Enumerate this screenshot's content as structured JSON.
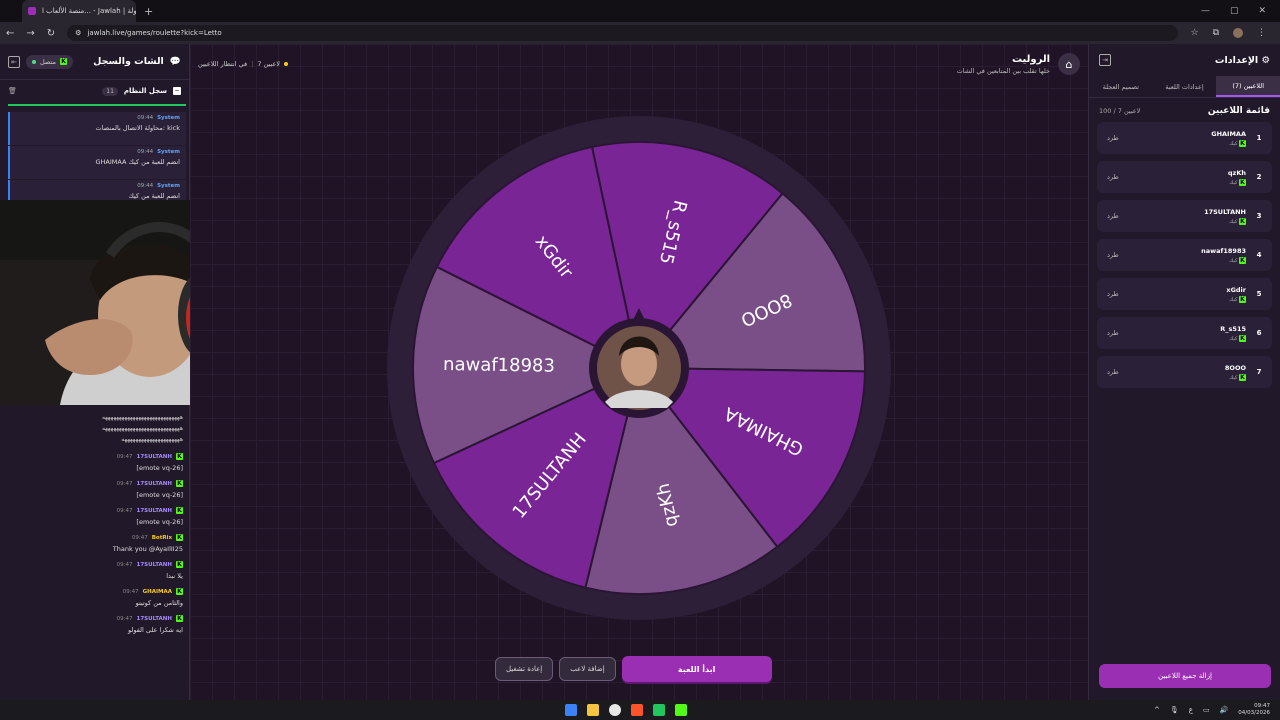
{
  "browser": {
    "tab_title": "منصة الألعاب ا... - Jawlah | جولة",
    "url": "jawlah.live/games/roulette?kick=Letto"
  },
  "left_panel": {
    "title": "الشات والسجل",
    "connection_status": "متصل",
    "system_log_label": "سجل النظام",
    "system_log_count": "11",
    "log": [
      {
        "who": "System",
        "time": "09:44",
        "text": "محاولة الاتصال بالمنصات: kick"
      },
      {
        "who": "System",
        "time": "09:44",
        "text": "GHAIMAA انضم للعبة من كيك"
      },
      {
        "who": "System",
        "time": "09:44",
        "text": "انضم للعبة من كيك"
      }
    ],
    "spam_lines": [
      "ههههههههههههههههههههههههههههه",
      "ههههههههههههههههههههههههههههه",
      "هههههههههههههههههههههه"
    ],
    "messages": [
      {
        "who": "17SULTANH",
        "time": "09:47",
        "text": "[emote vq-26]",
        "color": "#a78bfa"
      },
      {
        "who": "17SULTANH",
        "time": "09:47",
        "text": "[emote vq-26]",
        "color": "#a78bfa"
      },
      {
        "who": "17SULTANH",
        "time": "09:47",
        "text": "[emote vq-26]",
        "color": "#a78bfa"
      },
      {
        "who": "BotRix",
        "time": "09:47",
        "text": "Thank you @AyaIlII25",
        "color": "#facc15"
      },
      {
        "who": "17SULTANH",
        "time": "09:47",
        "text": "يلا نبدا",
        "color": "#a78bfa"
      },
      {
        "who": "GHAIMAA",
        "time": "09:47",
        "text": "والثامن من كوتيتو",
        "color": "#facc15"
      },
      {
        "who": "17SULTANH",
        "time": "09:47",
        "text": "ايه شكرا على الفولو",
        "color": "#a78bfa"
      }
    ]
  },
  "center": {
    "title": "الروليت",
    "subtitle": "خلها تقلب بين المتابعين في الشات",
    "player_count_label": "7 لاعبين",
    "waiting_label": "في انتظار اللاعبين",
    "wheel": {
      "segments": [
        "R_s515",
        "8OOO",
        "GHAIMAA",
        "qzKh",
        "17SULTANH",
        "nawaf18983",
        "xGdir"
      ],
      "color_a": "#7a2596",
      "color_b": "#7a4f87"
    },
    "buttons": {
      "restart": "إعادة تشغيل",
      "add_player": "إضافة لاعب",
      "start": "ابدأ اللعبة"
    }
  },
  "right_panel": {
    "title": "الإعدادات",
    "tabs": [
      "اللاعبين (7)",
      "إعدادات اللعبة",
      "تصميم العجلة"
    ],
    "list_title": "قائمة اللاعبين",
    "list_count": "100 / 7 لاعبين",
    "kick_label": "طرد",
    "platform_label": "كيك",
    "players": [
      {
        "idx": "1",
        "name": "GHAIMAA"
      },
      {
        "idx": "2",
        "name": "qzKh"
      },
      {
        "idx": "3",
        "name": "17SULTANH"
      },
      {
        "idx": "4",
        "name": "nawaf18983"
      },
      {
        "idx": "5",
        "name": "xGdir"
      },
      {
        "idx": "6",
        "name": "R_s515"
      },
      {
        "idx": "7",
        "name": "8OOO"
      }
    ],
    "remove_all": "إزالة جميع اللاعبين"
  },
  "taskbar": {
    "time": "09:47",
    "date": "04/03/2026",
    "lang": "ع"
  }
}
